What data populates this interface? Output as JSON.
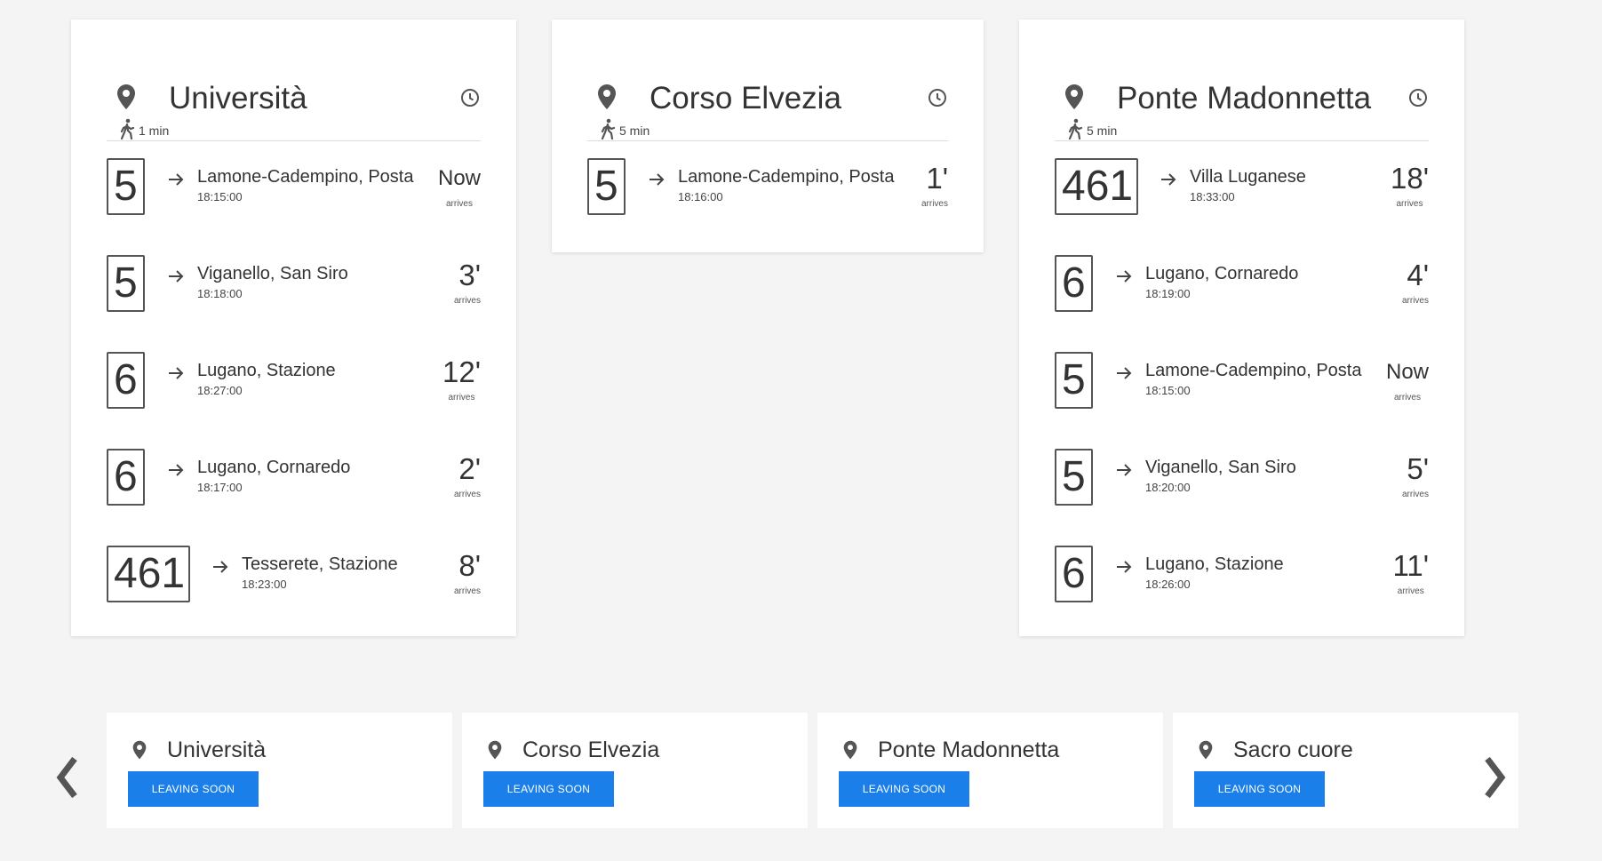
{
  "colors": {
    "accent": "#1a7fe8",
    "icon": "#555555"
  },
  "stops": [
    {
      "name": "Università",
      "walk": "1 min",
      "departures": [
        {
          "line": "5",
          "destination": "Lamone-Cadempino, Posta",
          "time": "18:15:00",
          "eta": "Now",
          "eta_label": "arrives"
        },
        {
          "line": "5",
          "destination": "Viganello, San Siro",
          "time": "18:18:00",
          "eta": "3'",
          "eta_label": "arrives"
        },
        {
          "line": "6",
          "destination": "Lugano, Stazione",
          "time": "18:27:00",
          "eta": "12'",
          "eta_label": "arrives"
        },
        {
          "line": "6",
          "destination": "Lugano, Cornaredo",
          "time": "18:17:00",
          "eta": "2'",
          "eta_label": "arrives"
        },
        {
          "line": "461",
          "destination": "Tesserete, Stazione",
          "time": "18:23:00",
          "eta": "8'",
          "eta_label": "arrives"
        }
      ]
    },
    {
      "name": "Corso Elvezia",
      "walk": "5 min",
      "departures": [
        {
          "line": "5",
          "destination": "Lamone-Cadempino, Posta",
          "time": "18:16:00",
          "eta": "1'",
          "eta_label": "arrives"
        }
      ]
    },
    {
      "name": "Ponte Madonnetta",
      "walk": "5 min",
      "departures": [
        {
          "line": "461",
          "destination": "Villa Luganese",
          "time": "18:33:00",
          "eta": "18'",
          "eta_label": "arrives"
        },
        {
          "line": "6",
          "destination": "Lugano, Cornaredo",
          "time": "18:19:00",
          "eta": "4'",
          "eta_label": "arrives"
        },
        {
          "line": "5",
          "destination": "Lamone-Cadempino, Posta",
          "time": "18:15:00",
          "eta": "Now",
          "eta_label": "arrives"
        },
        {
          "line": "5",
          "destination": "Viganello, San Siro",
          "time": "18:20:00",
          "eta": "5'",
          "eta_label": "arrives"
        },
        {
          "line": "6",
          "destination": "Lugano, Stazione",
          "time": "18:26:00",
          "eta": "11'",
          "eta_label": "arrives"
        }
      ]
    }
  ],
  "carousel": [
    {
      "name": "Università",
      "button": "LEAVING SOON"
    },
    {
      "name": "Corso Elvezia",
      "button": "LEAVING SOON"
    },
    {
      "name": "Ponte Madonnetta",
      "button": "LEAVING SOON"
    },
    {
      "name": "Sacro cuore",
      "button": "LEAVING SOON"
    }
  ],
  "icons": {
    "pin": "map-pin-icon",
    "clock": "clock-icon",
    "walk": "walking-person-icon",
    "arrow": "arrow-right-icon",
    "prev": "chevron-left-icon",
    "next": "chevron-right-icon"
  }
}
